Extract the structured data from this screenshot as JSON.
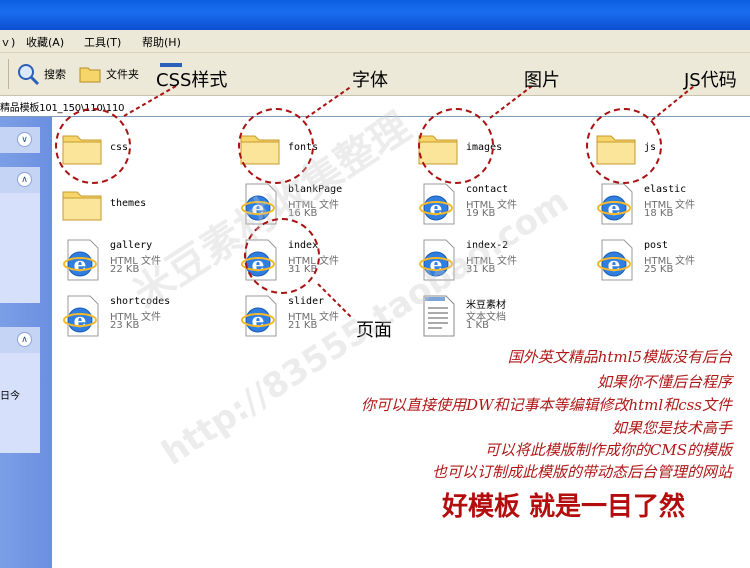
{
  "menu": [
    {
      "label": "ｖ)"
    },
    {
      "label": "收藏(A)"
    },
    {
      "label": "工具(T)"
    },
    {
      "label": "帮助(H)"
    }
  ],
  "toolbar": {
    "search_label": "搜索",
    "folders_label": "文件夹"
  },
  "address": {
    "path": "精品模板101_150\\110\\110"
  },
  "sidebar": {
    "panel3_text": "日今"
  },
  "files": [
    {
      "name": "css",
      "type": "",
      "size": "",
      "kind": "folder"
    },
    {
      "name": "fonts",
      "type": "",
      "size": "",
      "kind": "folder"
    },
    {
      "name": "images",
      "type": "",
      "size": "",
      "kind": "folder"
    },
    {
      "name": "js",
      "type": "",
      "size": "",
      "kind": "folder"
    },
    {
      "name": "themes",
      "type": "",
      "size": "",
      "kind": "folder"
    },
    {
      "name": "blankPage",
      "type": "HTML 文件",
      "size": "16 KB",
      "kind": "html"
    },
    {
      "name": "contact",
      "type": "HTML 文件",
      "size": "19 KB",
      "kind": "html"
    },
    {
      "name": "elastic",
      "type": "HTML 文件",
      "size": "18 KB",
      "kind": "html"
    },
    {
      "name": "gallery",
      "type": "HTML 文件",
      "size": "22 KB",
      "kind": "html"
    },
    {
      "name": "index",
      "type": "HTML 文件",
      "size": "31 KB",
      "kind": "html"
    },
    {
      "name": "index-2",
      "type": "HTML 文件",
      "size": "31 KB",
      "kind": "html"
    },
    {
      "name": "post",
      "type": "HTML 文件",
      "size": "25 KB",
      "kind": "html"
    },
    {
      "name": "shortcodes",
      "type": "HTML 文件",
      "size": "23 KB",
      "kind": "html"
    },
    {
      "name": "slider",
      "type": "HTML 文件",
      "size": "21 KB",
      "kind": "html"
    },
    {
      "name": "米豆素材",
      "type": "文本文档",
      "size": "1 KB",
      "kind": "text"
    }
  ],
  "callouts": {
    "css": "CSS样式",
    "fonts": "字体",
    "images": "图片",
    "js": "JS代码",
    "page": "页面"
  },
  "watermark": {
    "line1": "米豆素材收集整理",
    "line2": "http://83555.taobao.com"
  },
  "description": [
    "国外英文精品html5模版没有后台",
    "如果你不懂后台程序",
    "你可以直接使用DW和记事本等编辑修改html和css文件",
    "如果您是技术高手",
    "可以将此模版制作成你的CMS的模版",
    "也可以订制成此模版的带动态后台管理的网站"
  ],
  "slogan": "好模板 就是一目了然",
  "colors": {
    "accent_red": "#b01818",
    "xp_blue": "#0a5fe0",
    "folder_yellow": "#f6d56a"
  }
}
